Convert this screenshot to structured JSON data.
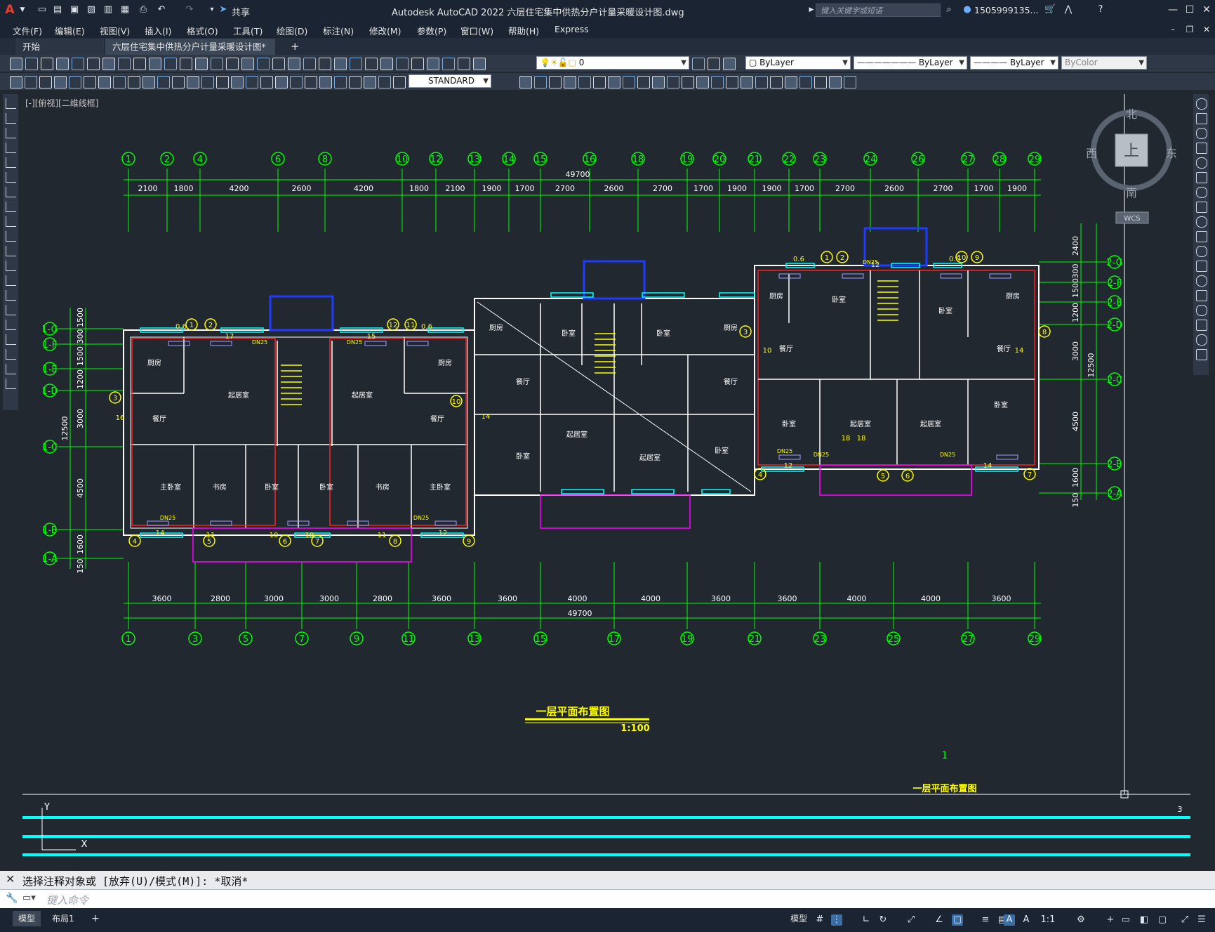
{
  "app": {
    "title": "Autodesk AutoCAD 2022    六层住宅集中供热分户计量采暖设计图.dwg",
    "share": "共享",
    "search_placeholder": "键入关键字或短语",
    "user": "1505999135...",
    "logo": "A"
  },
  "menus": [
    "文件(F)",
    "编辑(E)",
    "视图(V)",
    "插入(I)",
    "格式(O)",
    "工具(T)",
    "绘图(D)",
    "标注(N)",
    "修改(M)",
    "参数(P)",
    "窗口(W)",
    "帮助(H)",
    "Express"
  ],
  "tabs": {
    "start": "开始",
    "active": "六层住宅集中供热分户计量采暖设计图*",
    "close": "×",
    "add": "+"
  },
  "toolbar": {
    "layer": "0",
    "color": "ByLayer",
    "linetype": "ByLayer",
    "lineweight": "ByLayer",
    "plotstyle": "ByColor",
    "textstyle": "STANDARD"
  },
  "viewport": {
    "label": "[-][俯视][二维线框]"
  },
  "viewcube": {
    "n": "北",
    "s": "南",
    "e": "东",
    "w": "西",
    "face": "上",
    "wcs": "WCS"
  },
  "drawing": {
    "title": "一层平面布置图",
    "scale": "1:100",
    "overall_dim": "49700",
    "top_axes": [
      "1",
      "2",
      "4",
      "6",
      "8",
      "10",
      "12",
      "13",
      "14",
      "15",
      "16",
      "18",
      "19",
      "20",
      "21",
      "22",
      "23",
      "24",
      "26",
      "27",
      "28",
      "29"
    ],
    "top_dims": [
      "2100",
      "1800",
      "4200",
      "2600",
      "4200",
      "1800",
      "2100",
      "1900",
      "1700",
      "2700",
      "2600",
      "2700",
      "1700",
      "1900",
      "1900",
      "1700",
      "2700",
      "2600",
      "2700",
      "1700",
      "1900"
    ],
    "bottom_axes": [
      "1",
      "3",
      "5",
      "7",
      "9",
      "11",
      "13",
      "15",
      "17",
      "19",
      "21",
      "23",
      "25",
      "27",
      "29"
    ],
    "bottom_dims": [
      "3600",
      "2800",
      "3000",
      "3000",
      "2800",
      "3600",
      "3600",
      "4000",
      "4000",
      "3600",
      "3600",
      "4000",
      "4000",
      "3600"
    ],
    "left_dims": [
      "1500",
      "300",
      "1500",
      "1200",
      "3000",
      "4500",
      "1600",
      "150"
    ],
    "left_total": "12500",
    "left_axes": [
      "1-G",
      "1-F",
      "1-E",
      "1-D",
      "1-C",
      "1-B",
      "1-A"
    ],
    "right_dims": [
      "2400",
      "300",
      "1500",
      "1200",
      "3000",
      "4500",
      "1600",
      "150"
    ],
    "right_total": "12500",
    "right_axes": [
      "2-G",
      "2-F",
      "2-E",
      "2-D",
      "2-C",
      "2-B",
      "2-A"
    ],
    "left_unit_rooms": [
      "厨房",
      "起居室",
      "餐厅",
      "主卧室",
      "书房",
      "卧室",
      "卧室",
      "书房",
      "主卧室",
      "餐厅",
      "起居室",
      "厨房"
    ],
    "center_rooms": [
      "厨房",
      "卧室",
      "卧室",
      "厨房",
      "餐厅",
      "餐厅",
      "卧室",
      "起居室",
      "起居室",
      "卧室"
    ],
    "right_rooms": [
      "厨房",
      "卧室",
      "卧室",
      "厨房",
      "餐厅",
      "餐厅",
      "卧室",
      "起居室",
      "起居室",
      "卧室"
    ],
    "pipe_labels": [
      "DN25",
      "DN25",
      "DN25",
      "DN25",
      "DN25",
      "DN25",
      "DN25",
      "DN25"
    ],
    "radiator_nums": [
      "17",
      "15",
      "14",
      "11",
      "10",
      "10",
      "11",
      "12",
      "16",
      "14",
      "10",
      "12",
      "12",
      "14",
      "18",
      "18",
      "14",
      "0.6",
      "0.6",
      "0.6",
      "0.6"
    ],
    "circle_marks": [
      "1",
      "2",
      "3",
      "4",
      "5",
      "6",
      "7",
      "8",
      "9",
      "10",
      "11",
      "12"
    ],
    "side_label_num": "1",
    "side_label_title": "一层平面布置图",
    "paper_num": "3"
  },
  "command": {
    "history": "选择注释对象或 [放弃(U)/模式(M)]: *取消*",
    "placeholder": "键入命令"
  },
  "status": {
    "model": "模型",
    "layout1": "布局1",
    "model_btn": "模型",
    "scale": "1:1"
  },
  "colors": {
    "axis_green": "#00ff00",
    "wall": "#ffffff",
    "supply_red": "#ff2020",
    "cyan": "#00ffff",
    "yellow": "#ffff00",
    "blue": "#1e3cff",
    "magenta": "#ff00ff"
  }
}
